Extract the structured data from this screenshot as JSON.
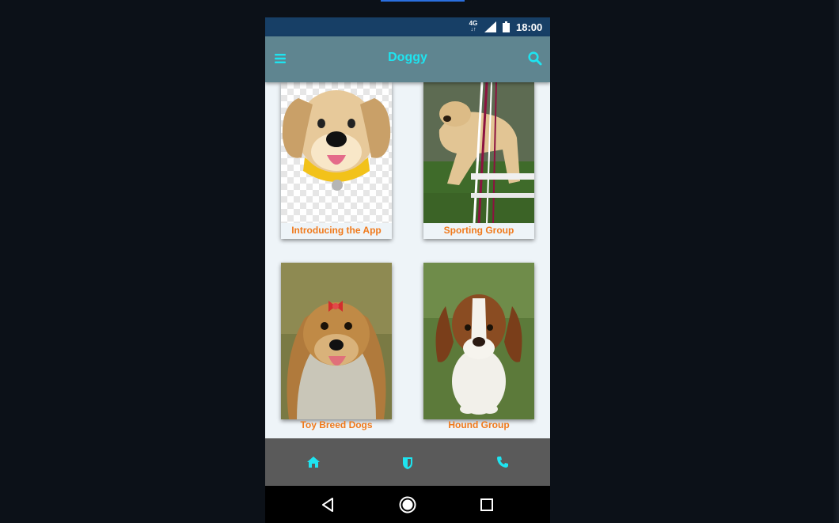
{
  "status_bar": {
    "network": "4G",
    "time": "18:00"
  },
  "app_bar": {
    "title": "Doggy",
    "menu_icon": "hamburger-menu-icon",
    "search_icon": "search-icon"
  },
  "cards": [
    {
      "label": "Introducing the App",
      "image": "cartoon-dog-emoji-image"
    },
    {
      "label": "Sporting Group",
      "image": "dog-weave-poles-image"
    },
    {
      "label": "Toy Breed Dogs",
      "image": "yorkshire-terrier-image"
    },
    {
      "label": "Hound Group",
      "image": "basset-hound-image"
    }
  ],
  "bottom_nav": [
    {
      "name": "home",
      "icon": "home-icon"
    },
    {
      "name": "shield",
      "icon": "shield-icon"
    },
    {
      "name": "phone",
      "icon": "phone-icon"
    }
  ],
  "system_nav": [
    "back-icon",
    "home-circle-icon",
    "recents-icon"
  ],
  "colors": {
    "status_bar": "#173f66",
    "app_bar": "#5f8590",
    "accent_cyan": "#1ee4f0",
    "label_orange": "#f07a1c",
    "bottom_nav": "#5a5a5a"
  }
}
